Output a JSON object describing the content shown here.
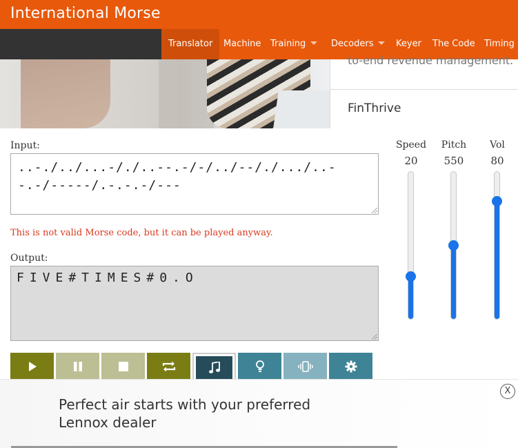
{
  "app": {
    "title": "International Morse"
  },
  "nav": {
    "items": [
      {
        "label": "Translator"
      },
      {
        "label": "Machine"
      },
      {
        "label": "Training"
      },
      {
        "label": "Decoders"
      },
      {
        "label": "Keyer"
      },
      {
        "label": "The Code"
      },
      {
        "label": "Timing"
      }
    ],
    "active": "Translator"
  },
  "banner_ad": {
    "tagline": "to-end revenue management.",
    "company": "FinThrive"
  },
  "input": {
    "label": "Input:",
    "value": "..-./../...-/./..--.-/-/../--/./.../..-\n-.-/-----/.-.-.-/---"
  },
  "error": {
    "message": "This is not valid Morse code, but it can be played anyway."
  },
  "output": {
    "label": "Output:",
    "value": "FIVE#TIMES#0.O"
  },
  "sliders": [
    {
      "name": "Speed",
      "value": "20",
      "level": 0.29
    },
    {
      "name": "Pitch",
      "value": "550",
      "level": 0.5
    },
    {
      "name": "Vol",
      "value": "80",
      "level": 0.8
    }
  ],
  "controls": [
    {
      "name": "play",
      "icon": "play-icon"
    },
    {
      "name": "pause",
      "icon": "pause-icon"
    },
    {
      "name": "stop",
      "icon": "stop-icon"
    },
    {
      "name": "repeat",
      "icon": "repeat-icon"
    },
    {
      "name": "sound",
      "icon": "music-note-icon",
      "selected": true
    },
    {
      "name": "light",
      "icon": "lightbulb-icon"
    },
    {
      "name": "vibrate",
      "icon": "vibrate-icon"
    },
    {
      "name": "settings",
      "icon": "gear-icon"
    }
  ],
  "bottom_ad": {
    "text": "Perfect air starts with your preferred Lennox dealer",
    "close_label": "X"
  },
  "colors": {
    "brand_orange": "#e8590c",
    "nav_dark": "#333333",
    "error_red": "#d9381e",
    "slider_blue": "#1a73e8",
    "olive": "#7a7d14",
    "teal": "#3e8496"
  }
}
